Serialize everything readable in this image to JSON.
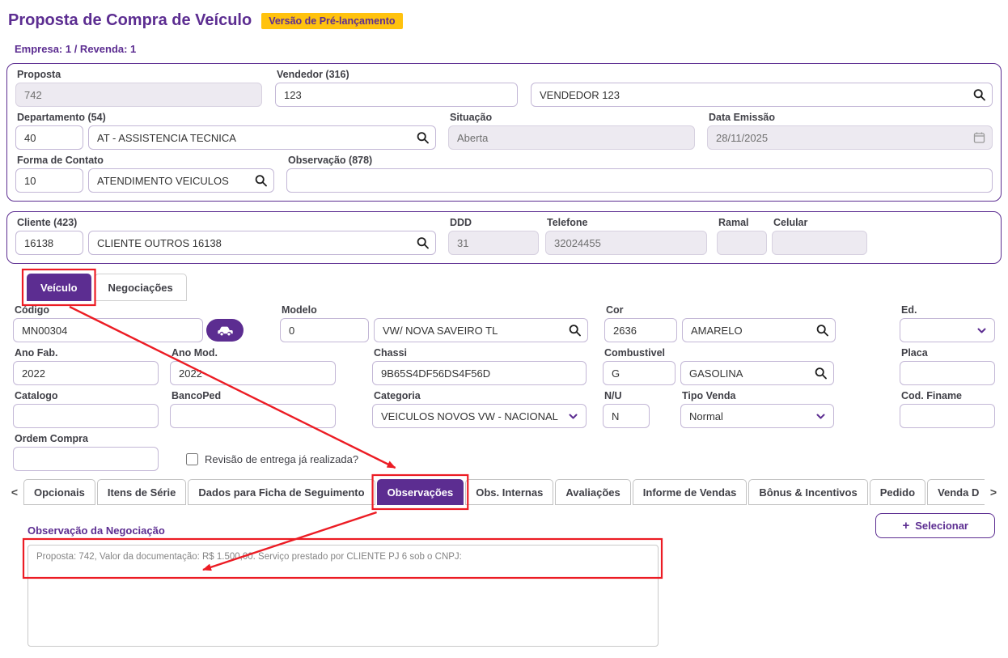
{
  "page": {
    "title": "Proposta de Compra de Veículo",
    "badge": "Versão de Pré-lançamento",
    "context": "Empresa: 1 / Revenda: 1"
  },
  "proposal": {
    "proposta": {
      "label": "Proposta",
      "value": "742"
    },
    "vendedor": {
      "label": "Vendedor (316)",
      "code": "123",
      "name": "VENDEDOR 123"
    },
    "departamento": {
      "label": "Departamento (54)",
      "code": "40",
      "name": "AT - ASSISTENCIA TECNICA"
    },
    "situacao": {
      "label": "Situação",
      "value": "Aberta"
    },
    "data_emissao": {
      "label": "Data Emissão",
      "value": "28/11/2025"
    },
    "forma_contato": {
      "label": "Forma de Contato",
      "code": "10",
      "name": "ATENDIMENTO VEICULOS"
    },
    "observacao": {
      "label": "Observação (878)",
      "value": ""
    }
  },
  "cliente": {
    "cliente": {
      "label": "Cliente (423)",
      "code": "16138",
      "name": "CLIENTE OUTROS 16138"
    },
    "ddd": {
      "label": "DDD",
      "value": "31"
    },
    "telefone": {
      "label": "Telefone",
      "value": "32024455"
    },
    "ramal": {
      "label": "Ramal",
      "value": ""
    },
    "celular": {
      "label": "Celular",
      "value": ""
    }
  },
  "main_tabs": [
    {
      "label": "Veículo",
      "active": true
    },
    {
      "label": "Negociações",
      "active": false
    }
  ],
  "vehicle": {
    "codigo": {
      "label": "Código",
      "value": "MN00304"
    },
    "modelo": {
      "label": "Modelo",
      "code": "0",
      "name": "VW/ NOVA SAVEIRO TL"
    },
    "cor": {
      "label": "Cor",
      "code": "2636",
      "name": "AMARELO"
    },
    "ed": {
      "label": "Ed.",
      "value": ""
    },
    "ano_fab": {
      "label": "Ano Fab.",
      "value": "2022"
    },
    "ano_mod": {
      "label": "Ano Mod.",
      "value": "2022"
    },
    "chassi": {
      "label": "Chassi",
      "value": "9B65S4DF56DS4F56D"
    },
    "combustivel": {
      "label": "Combustivel",
      "code": "G",
      "name": "GASOLINA"
    },
    "placa": {
      "label": "Placa",
      "value": ""
    },
    "catalogo": {
      "label": "Catalogo",
      "value": ""
    },
    "bancoped": {
      "label": "BancoPed",
      "value": ""
    },
    "categoria": {
      "label": "Categoria",
      "value": "VEICULOS NOVOS VW - NACIONAL"
    },
    "nu": {
      "label": "N/U",
      "value": "N"
    },
    "tipo_venda": {
      "label": "Tipo Venda",
      "value": "Normal"
    },
    "cod_finame": {
      "label": "Cod. Finame",
      "value": ""
    },
    "ordem_compra": {
      "label": "Ordem Compra",
      "value": ""
    },
    "revisao_checkbox": {
      "label": "Revisão de entrega já realizada?",
      "checked": false
    }
  },
  "detail_tab_strip": {
    "left_chevron": "<",
    "right_chevron": ">"
  },
  "detail_tabs": [
    {
      "label": "Opcionais",
      "active": false
    },
    {
      "label": "Itens de Série",
      "active": false
    },
    {
      "label": "Dados para Ficha de Seguimento",
      "active": false
    },
    {
      "label": "Observações",
      "active": true
    },
    {
      "label": "Obs. Internas",
      "active": false
    },
    {
      "label": "Avaliações",
      "active": false
    },
    {
      "label": "Informe de Vendas",
      "active": false
    },
    {
      "label": "Bônus & Incentivos",
      "active": false
    },
    {
      "label": "Pedido",
      "active": false
    },
    {
      "label": "Venda D",
      "active": false
    }
  ],
  "observacoes": {
    "section_label": "Observação da Negociação",
    "plus_glyph": "+",
    "selecionar_label": "Selecionar",
    "text": "Proposta: 742, Valor da documentação: R$ 1.500,00. Serviço prestado por CLIENTE PJ 6 sob o CNPJ:"
  },
  "colors": {
    "primary": "#5C2D91",
    "badge_bg": "#FFC20E",
    "annotation_red": "#EC1C24",
    "disabled_bg": "#EDEAF1"
  }
}
